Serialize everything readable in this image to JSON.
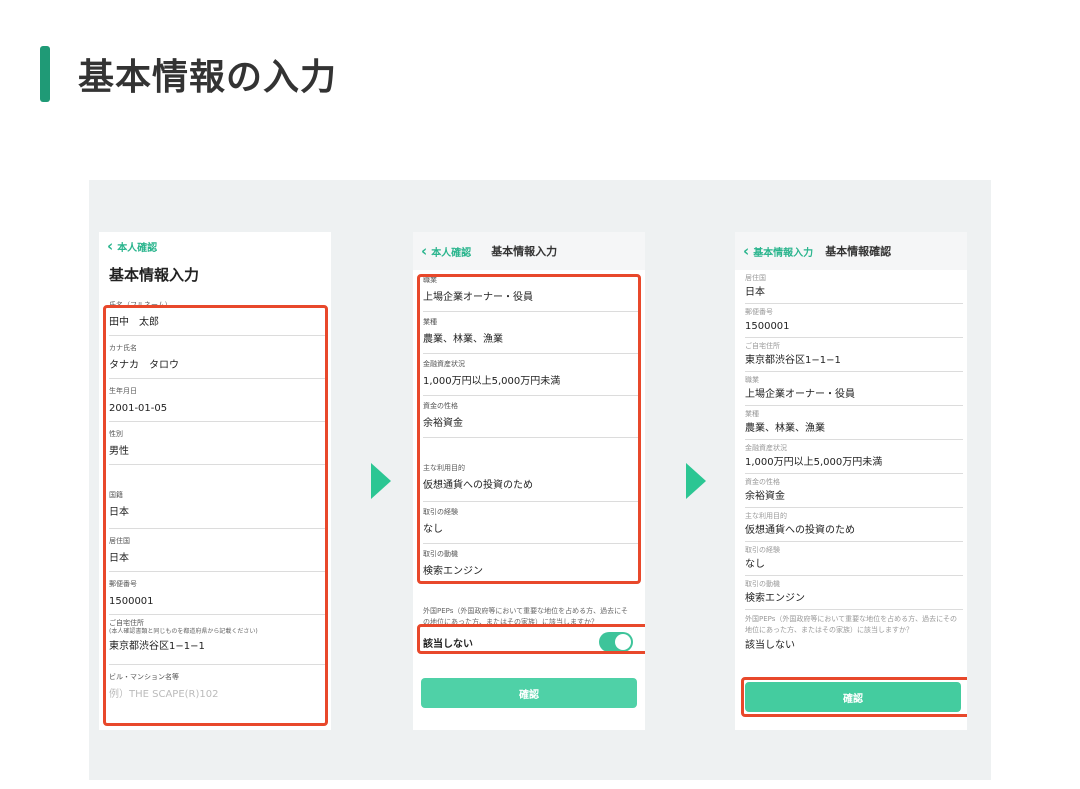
{
  "heading": {
    "title": "基本情報の入力"
  },
  "screen1": {
    "back_label": "本人確認",
    "title": "基本情報入力",
    "fields": [
      {
        "label": "氏名（フルネーム）",
        "value": "田中　太郎"
      },
      {
        "label": "カナ氏名",
        "value": "タナカ　タロウ"
      },
      {
        "label": "生年月日",
        "value": "2001-01-05"
      },
      {
        "label": "性別",
        "value": "男性"
      },
      {
        "label": "国籍",
        "value": "日本"
      },
      {
        "label": "居住国",
        "value": "日本"
      },
      {
        "label": "郵便番号",
        "value": "1500001"
      },
      {
        "label": "ご自宅住所",
        "sublabel": "(本人確認書類と同じものを都道府県から記載ください)",
        "value": "東京都渋谷区1−1−1"
      },
      {
        "label": "ビル・マンション名等",
        "placeholder": "例）THE SCAPE(R)102"
      }
    ]
  },
  "screen2": {
    "back_label": "本人確認",
    "title": "基本情報入力",
    "fields": [
      {
        "label": "職業",
        "value": "上場企業オーナー・役員"
      },
      {
        "label": "業種",
        "value": "農業、林業、漁業"
      },
      {
        "label": "金融資産状況",
        "value": "1,000万円以上5,000万円未満"
      },
      {
        "label": "資金の性格",
        "value": "余裕資金"
      },
      {
        "label": "主な利用目的",
        "value": "仮想通貨への投資のため"
      },
      {
        "label": "取引の経験",
        "value": "なし"
      },
      {
        "label": "取引の動機",
        "value": "検索エンジン"
      }
    ],
    "pep_question": "外国PEPs（外国政府等において重要な地位を占める方、過去にその地位にあった方、またはその家族）に該当しますか？",
    "toggle_label": "該当しない",
    "confirm_button": "確認"
  },
  "screen3": {
    "back_label": "基本情報入力",
    "title": "基本情報確認",
    "fields": [
      {
        "label": "居住国",
        "value": "日本"
      },
      {
        "label": "郵便番号",
        "value": "1500001"
      },
      {
        "label": "ご自宅住所",
        "value": "東京都渋谷区1−1−1"
      },
      {
        "label": "職業",
        "value": "上場企業オーナー・役員"
      },
      {
        "label": "業種",
        "value": "農業、林業、漁業"
      },
      {
        "label": "金融資産状況",
        "value": "1,000万円以上5,000万円未満"
      },
      {
        "label": "資金の性格",
        "value": "余裕資金"
      },
      {
        "label": "主な利用目的",
        "value": "仮想通貨への投資のため"
      },
      {
        "label": "取引の経験",
        "value": "なし"
      },
      {
        "label": "取引の動機",
        "value": "検索エンジン"
      }
    ],
    "pep_question": "外国PEPs（外国政府等において重要な地位を占める方、過去にその地位にあった方、またはその家族）に該当しますか？",
    "pep_answer": "該当しない",
    "confirm_button": "確認"
  },
  "colors": {
    "accent": "#2bb58e",
    "button": "#4fd1a7",
    "highlight": "#e8482b",
    "heading_bar": "#1f9a76"
  }
}
